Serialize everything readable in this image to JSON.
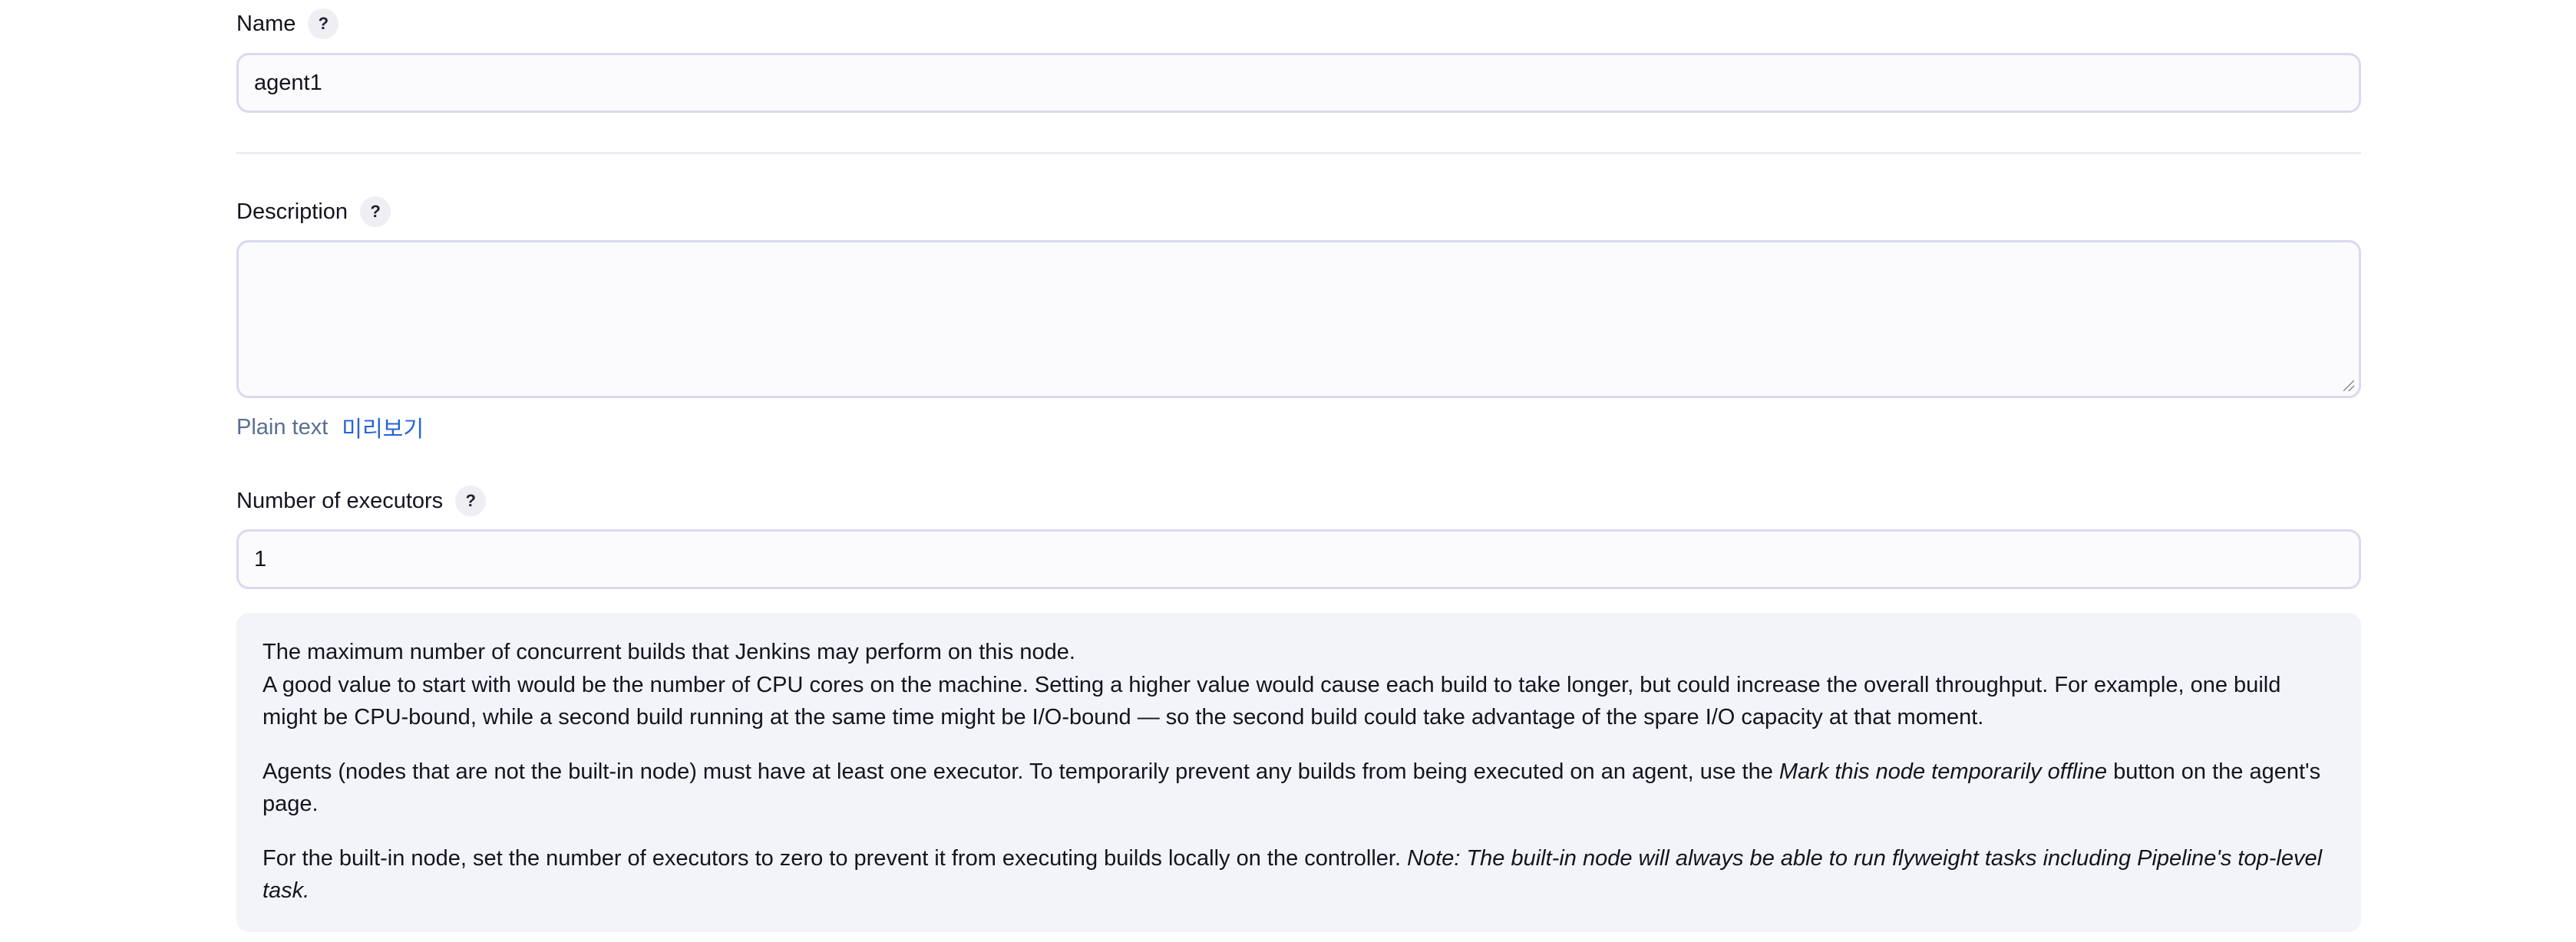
{
  "name_field": {
    "label": "Name",
    "help": "?",
    "value": "agent1"
  },
  "description_field": {
    "label": "Description",
    "help": "?",
    "value": "",
    "format_label": "Plain text",
    "preview_link": "미리보기"
  },
  "executors_field": {
    "label": "Number of executors",
    "help": "?",
    "value": "1"
  },
  "executors_help": {
    "p1_line1": "The maximum number of concurrent builds that Jenkins may perform on this node.",
    "p1_line2": "A good value to start with would be the number of CPU cores on the machine. Setting a higher value would cause each build to take longer, but could increase the overall throughput. For example, one build might be CPU-bound, while a second build running at the same time might be I/O-bound — so the second build could take advantage of the spare I/O capacity at that moment.",
    "p2_before": "Agents (nodes that are not the built-in node) must have at least one executor. To temporarily prevent any builds from being executed on an agent, use the ",
    "p2_emphasis": "Mark this node temporarily offline",
    "p2_after": " button on the agent's page.",
    "p3_before": "For the built-in node, set the number of executors to zero to prevent it from executing builds locally on the controller. ",
    "p3_emphasis": "Note: The built-in node will always be able to run flyweight tasks including Pipeline's top-level task."
  }
}
